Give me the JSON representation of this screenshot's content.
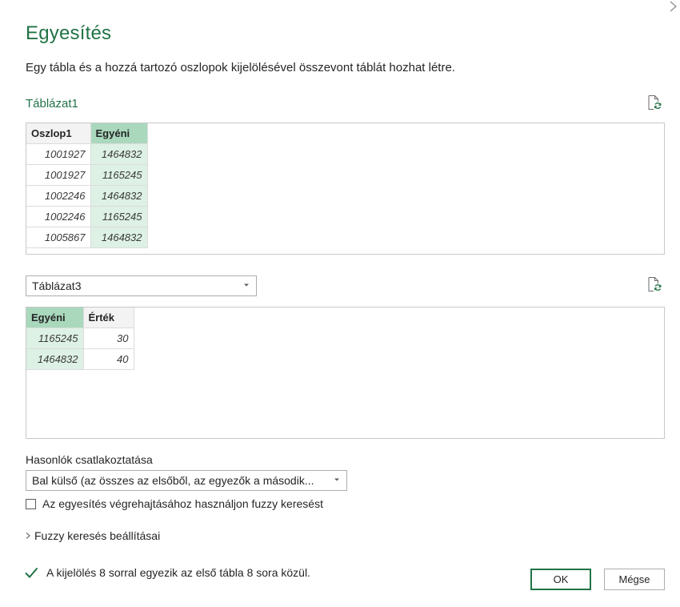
{
  "dialog": {
    "title": "Egyesítés",
    "description": "Egy tábla és a hozzá tartozó oszlopok kijelölésével összevont táblát hozhat létre."
  },
  "table1": {
    "label": "Táblázat1",
    "columns": [
      "Oszlop1",
      "Egyéni"
    ],
    "selected_column": "Egyéni",
    "rows": [
      [
        "1001927",
        "1464832"
      ],
      [
        "1001927",
        "1165245"
      ],
      [
        "1002246",
        "1464832"
      ],
      [
        "1002246",
        "1165245"
      ],
      [
        "1005867",
        "1464832"
      ]
    ]
  },
  "table2": {
    "selected_value": "Táblázat3",
    "columns": [
      "Egyéni",
      "Érték"
    ],
    "selected_column": "Egyéni",
    "rows": [
      [
        "1165245",
        "30"
      ],
      [
        "1464832",
        "40"
      ]
    ]
  },
  "join": {
    "label": "Hasonlók csatlakoztatása",
    "selected_value": "Bal külső (az összes az elsőből, az egyezők a második..."
  },
  "fuzzy": {
    "checkbox_label": "Az egyesítés végrehajtásához használjon fuzzy keresést",
    "checked": false,
    "settings_label": "Fuzzy keresés beállításai"
  },
  "status": {
    "text": "A kijelölés 8 sorral egyezik az első tábla 8 sora közül."
  },
  "buttons": {
    "ok": "OK",
    "cancel": "Mégse"
  },
  "colors": {
    "accent": "#217346",
    "selected_header": "#a9d8bd",
    "selected_cell": "#ddf1e4"
  },
  "icons": {
    "close": "close-icon",
    "refresh": "refresh-icon",
    "dropdown": "chevron-down-icon",
    "expand": "chevron-right-icon",
    "status": "check-icon"
  }
}
